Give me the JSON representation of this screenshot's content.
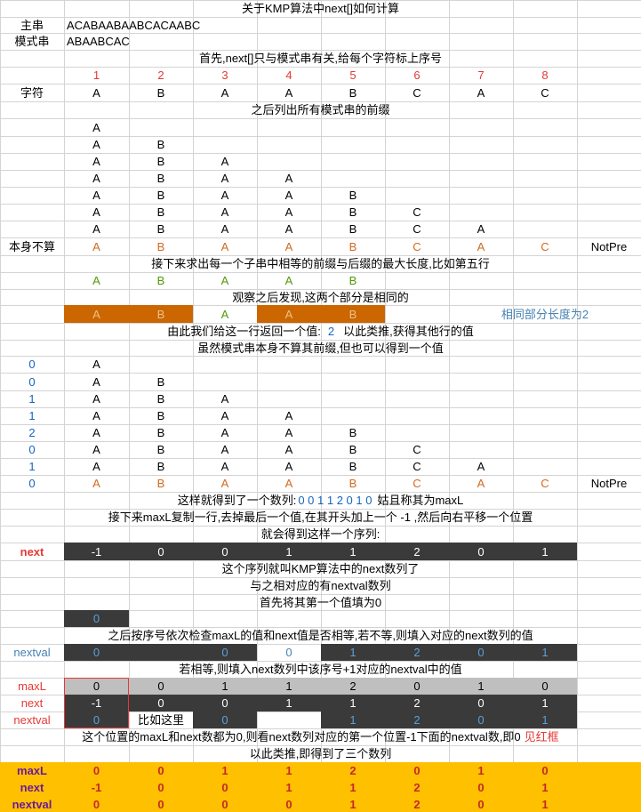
{
  "title": "关于KMP算法中next[]如何计算",
  "main_string": {
    "label": "主串",
    "value": "ACABAABAABCACAABC"
  },
  "pattern": {
    "label": "模式串",
    "value": "ABAABCAC"
  },
  "text_step1": "首先,next[]只与模式串有关,给每个字符标上序号",
  "indices": [
    "1",
    "2",
    "3",
    "4",
    "5",
    "6",
    "7",
    "8"
  ],
  "char_label": "字符",
  "chars": [
    "A",
    "B",
    "A",
    "A",
    "B",
    "C",
    "A",
    "C"
  ],
  "text_step2": "之后列出所有模式串的前缀",
  "self_label": "本身不算",
  "not_pre": "NotPre",
  "text_step3": "接下来求出每一个子串中相等的前缀与后缀的最大长度,比如第五行",
  "text_step4": "观察之后发现,这两个部分是相同的",
  "same_len_note": "相同部分长度为2",
  "text_step5_a": "由此我们给这一行返回一个值:",
  "text_step5_val": "2",
  "text_step5_b": "以此类推,获得其他行的值",
  "text_step6": "虽然模式串本身不算其前缀,但也可以得到一个值",
  "maxl_values": [
    "0",
    "0",
    "1",
    "1",
    "2",
    "0",
    "1",
    "0"
  ],
  "text_step7_a": "这样就得到了一个数列:",
  "text_step7_seq": "0 0 1 1 2 0 1 0",
  "text_step7_b": "姑且称其为maxL",
  "text_step8": "接下来maxL复制一行,去掉最后一个值,在其开头加上一个 -1 ,然后向右平移一个位置",
  "text_step9": "就会得到这样一个序列:",
  "next_label": "next",
  "next_values": [
    "-1",
    "0",
    "0",
    "1",
    "1",
    "2",
    "0",
    "1"
  ],
  "text_step10": "这个序列就叫KMP算法中的next数列了",
  "text_step11": "与之相对应的有nextval数列",
  "text_step12": "首先将其第一个值填为0",
  "first_val": "0",
  "text_step13": "之后按序号依次检查maxL的值和next值是否相等,若不等,则填入对应的next数列的值",
  "nextval_label": "nextval",
  "text_step14": "若相等,则填入next数列中该序号+1对应的nextval中的值",
  "maxl_label": "maxL",
  "here_note": "比如这里",
  "text_step15_a": "这个位置的maxL和next数都为0,则看next数列对应的第一个位置-1下面的nextval数,即0",
  "text_step15_b": "见红框",
  "text_step16": "以此类推,即得到了三个数列",
  "nextval_values": [
    "0",
    "0",
    "0",
    "0",
    "1",
    "2",
    "0",
    "1"
  ]
}
